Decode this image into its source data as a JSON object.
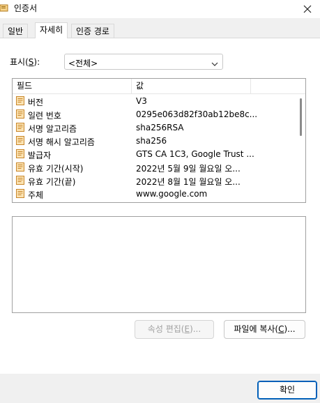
{
  "window": {
    "title": "인증서",
    "close_icon": "close-icon"
  },
  "tabs": [
    {
      "label": "일반"
    },
    {
      "label": "자세히"
    },
    {
      "label": "인증 경로"
    }
  ],
  "show": {
    "label": "표시(S):",
    "label_prefix": "표시(",
    "label_accel": "S",
    "label_suffix": "):",
    "selected": "<전체>"
  },
  "list": {
    "columns": [
      "필드",
      "값"
    ],
    "rows": [
      {
        "field": "버전",
        "value": "V3"
      },
      {
        "field": "일련 번호",
        "value": "0295e063d82f30ab12be8c..."
      },
      {
        "field": "서명 알고리즘",
        "value": "sha256RSA"
      },
      {
        "field": "서명 해시 알고리즘",
        "value": "sha256"
      },
      {
        "field": "발급자",
        "value": "GTS CA 1C3, Google Trust ..."
      },
      {
        "field": "유효 기간(시작)",
        "value": "2022년 5월 9일 월요일 오..."
      },
      {
        "field": "유효 기간(끝)",
        "value": "2022년 8월 1일 월요일 오..."
      },
      {
        "field": "주체",
        "value": "www.google.com"
      }
    ]
  },
  "buttons": {
    "edit_prefix": "속성 편집(",
    "edit_accel": "E",
    "edit_suffix": ")...",
    "copy_prefix": "파일에 복사(",
    "copy_accel": "C",
    "copy_suffix": ")...",
    "ok": "확인"
  },
  "colors": {
    "accent": "#005fb8",
    "cert_icon": "#e8a33d"
  }
}
